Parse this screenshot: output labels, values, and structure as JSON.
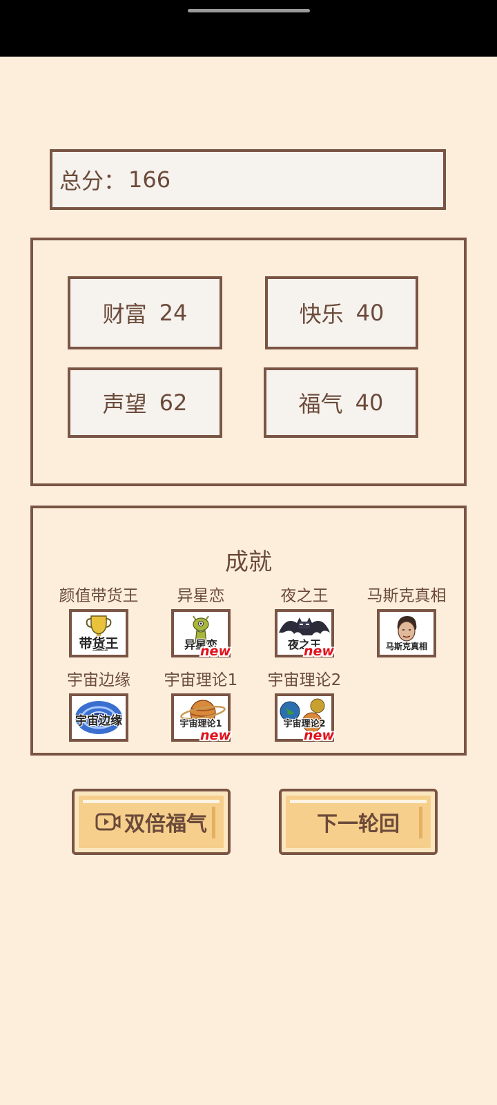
{
  "score": {
    "label": "总分：",
    "value": "166"
  },
  "stats": [
    {
      "label": "财富",
      "value": "24"
    },
    {
      "label": "快乐",
      "value": "40"
    },
    {
      "label": "声望",
      "value": "62"
    },
    {
      "label": "福气",
      "value": "40"
    }
  ],
  "achievements": {
    "title": "成就",
    "items": [
      {
        "label": "颜值带货王",
        "icon_text": "带货王",
        "icon": "trophy-icon",
        "is_new": false
      },
      {
        "label": "异星恋",
        "icon_text": "异星恋",
        "icon": "alien-icon",
        "is_new": true
      },
      {
        "label": "夜之王",
        "icon_text": "夜之王",
        "icon": "bat-icon",
        "is_new": true
      },
      {
        "label": "马斯克真相",
        "icon_text": "马斯克真相",
        "icon": "face-icon",
        "is_new": false
      },
      {
        "label": "宇宙边缘",
        "icon_text": "宇宙边缘",
        "icon": "galaxy-icon",
        "is_new": false
      },
      {
        "label": "宇宙理论1",
        "icon_text": "宇宙理论1",
        "icon": "planet-icon",
        "is_new": true
      },
      {
        "label": "宇宙理论2",
        "icon_text": "宇宙理论2",
        "icon": "planets-icon",
        "is_new": true
      }
    ],
    "new_label": "new"
  },
  "buttons": {
    "double_luck": "双倍福气",
    "next_round": "下一轮回"
  },
  "colors": {
    "background": "#fdeedc",
    "border": "#7a5444",
    "text": "#6b4a3a",
    "button": "#f6cf8c",
    "new_badge": "#e0121c"
  }
}
